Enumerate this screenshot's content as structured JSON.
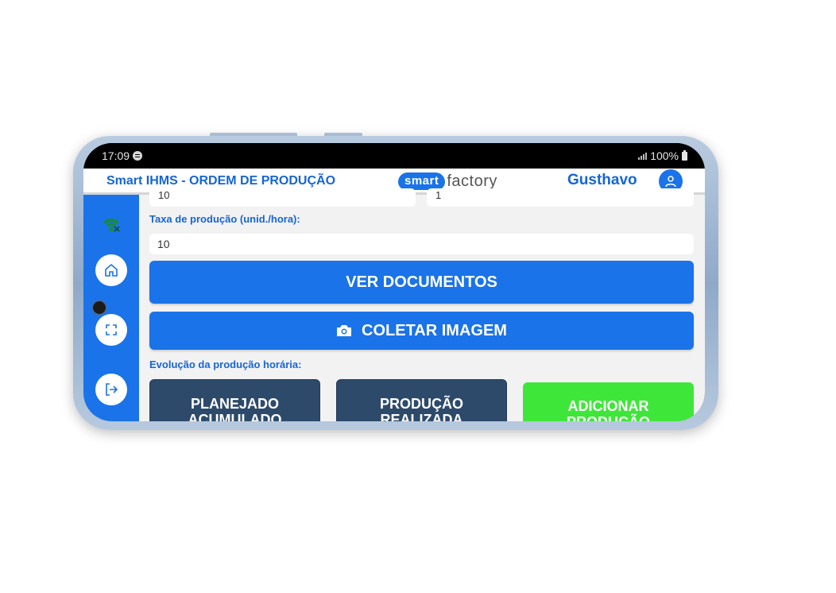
{
  "status_bar": {
    "time": "17:09",
    "battery": "100%"
  },
  "header": {
    "title": "Smart IHMS - ORDEM DE PRODUÇÃO",
    "logo_smart": "smart",
    "logo_factory": "factory",
    "user_name": "Gusthavo"
  },
  "form": {
    "partial_left_value": "10",
    "partial_right_value": "1",
    "rate_label": "Taxa de produção (unid./hora):",
    "rate_value": "10"
  },
  "buttons": {
    "view_documents": "VER DOCUMENTOS",
    "collect_image": "COLETAR IMAGEM"
  },
  "evolution": {
    "label": "Evolução da produção horária:",
    "planned_line1": "PLANEJADO",
    "planned_line2": "ACUMULADO",
    "realized_line1": "PRODUÇÃO",
    "realized_line2": "REALIZADA",
    "add_line1": "ADICIONAR",
    "add_line2": "PRODUÇÃO"
  },
  "colors": {
    "primary": "#1a73e8",
    "dark_card": "#2d4a6b",
    "green": "#3fe63a"
  },
  "icons": [
    "wifi-icon",
    "home-icon",
    "fullscreen-icon",
    "logout-icon",
    "camera-icon",
    "user-icon",
    "spotify-icon",
    "signal-icon",
    "battery-icon"
  ]
}
